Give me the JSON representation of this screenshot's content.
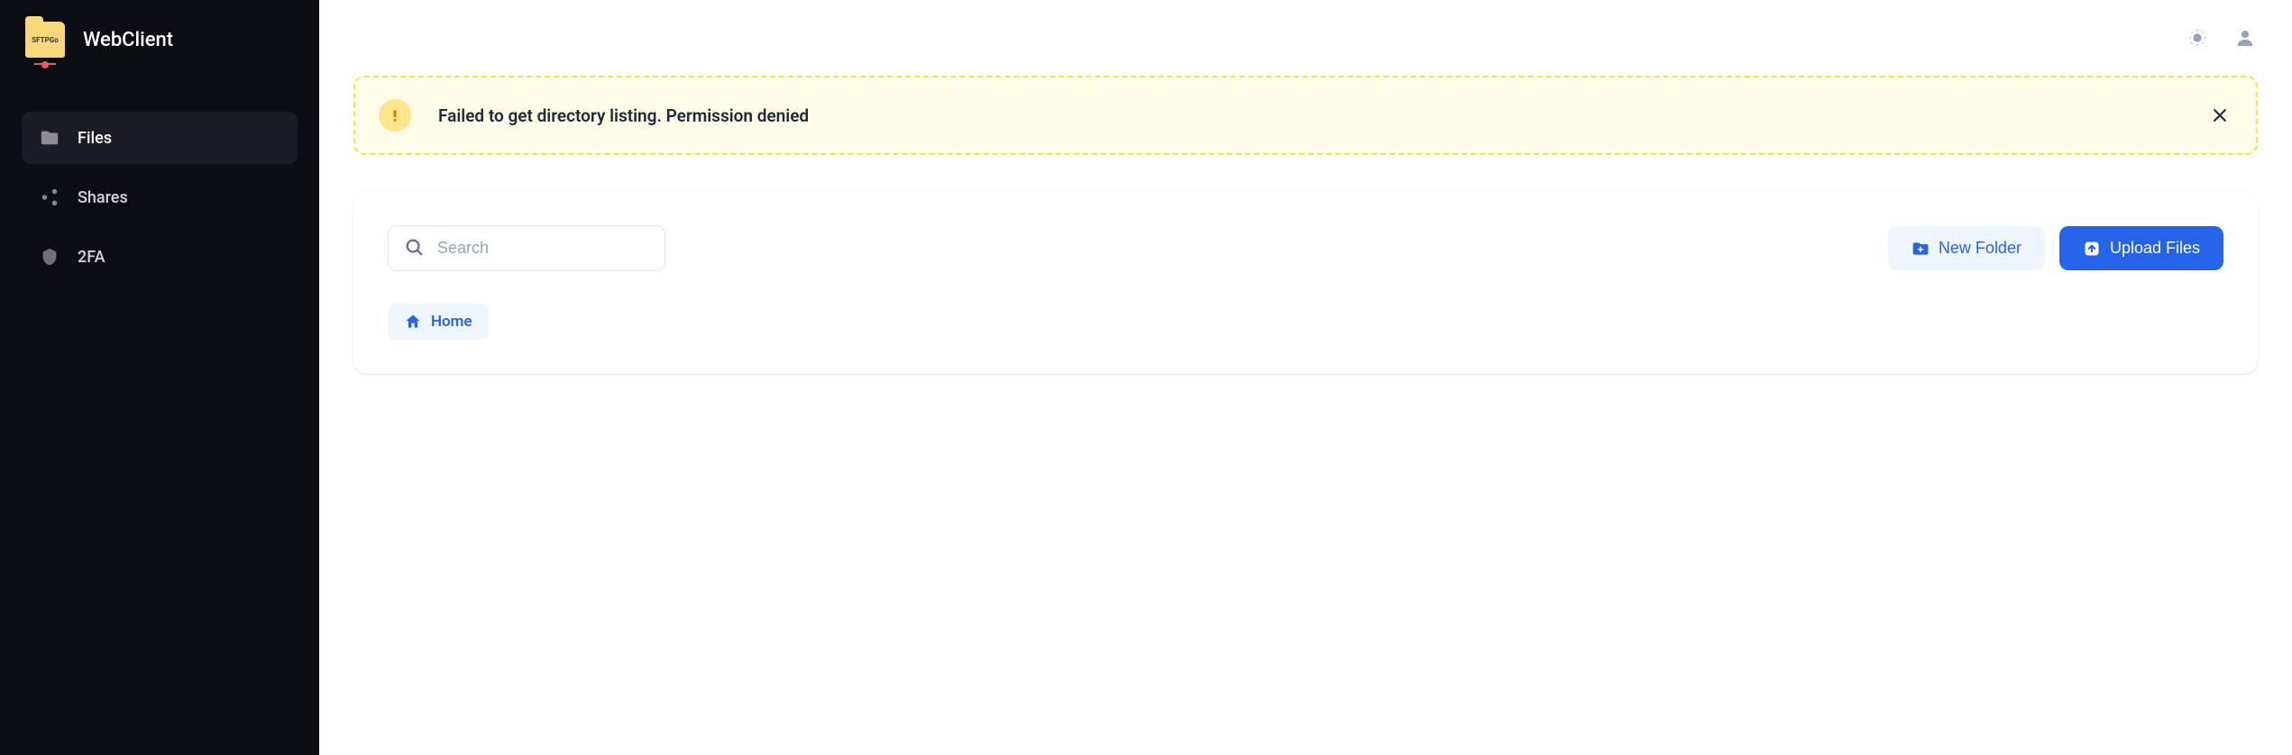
{
  "app": {
    "title": "WebClient",
    "logo_text": "SFTPGo"
  },
  "sidebar": {
    "items": [
      {
        "label": "Files",
        "active": true
      },
      {
        "label": "Shares",
        "active": false
      },
      {
        "label": "2FA",
        "active": false
      }
    ]
  },
  "alert": {
    "message": "Failed to get directory listing. Permission denied"
  },
  "toolbar": {
    "search_placeholder": "Search",
    "new_folder_label": "New Folder",
    "upload_files_label": "Upload Files"
  },
  "breadcrumb": {
    "home_label": "Home"
  }
}
